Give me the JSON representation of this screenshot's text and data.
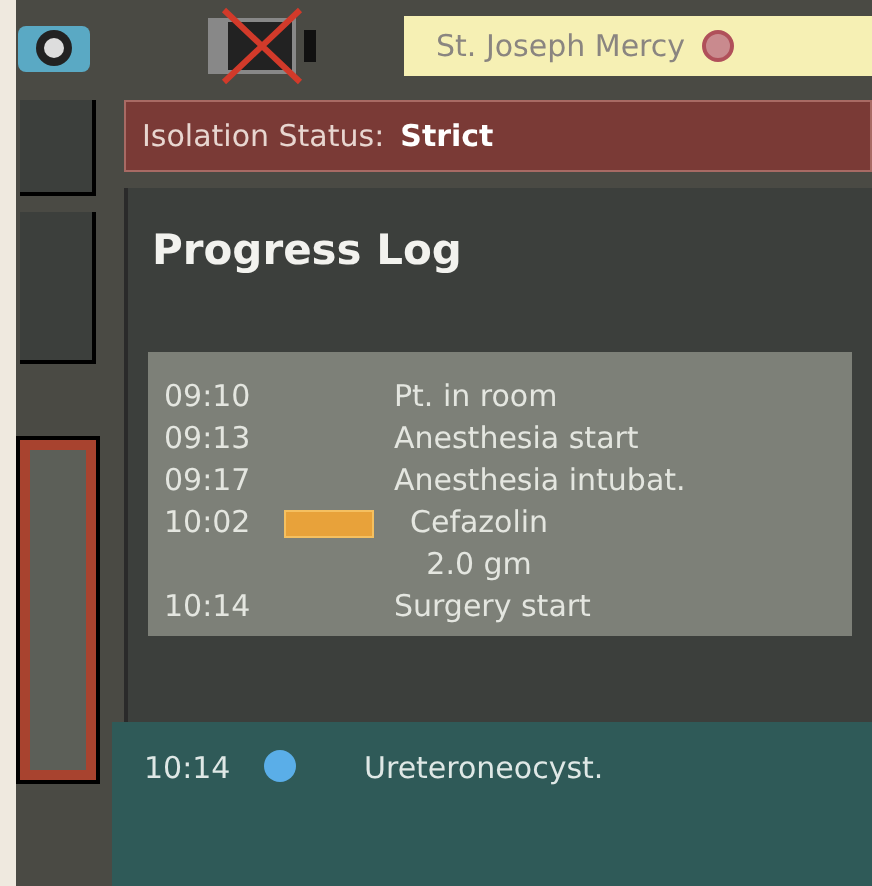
{
  "header": {
    "facility": "St. Joseph Mercy",
    "alert": true
  },
  "isolation": {
    "label": "Isolation Status:",
    "value": "Strict"
  },
  "progress_log": {
    "title": "Progress Log",
    "entries": [
      {
        "time": "09:10",
        "event": "Pt. in room",
        "flagged": false,
        "selected": false
      },
      {
        "time": "09:13",
        "event": "Anesthesia start",
        "flagged": false,
        "selected": false
      },
      {
        "time": "09:17",
        "event": "Anesthesia intubat.",
        "flagged": false,
        "selected": false
      },
      {
        "time": "10:02",
        "event": "Cefazolin",
        "detail": "2.0 gm",
        "flagged": true,
        "selected": false
      },
      {
        "time": "10:14",
        "event": "Surgery start",
        "flagged": false,
        "selected": false
      },
      {
        "time": "10:14",
        "event": "Ureteroneocyst.",
        "flagged": false,
        "selected": true
      }
    ]
  }
}
